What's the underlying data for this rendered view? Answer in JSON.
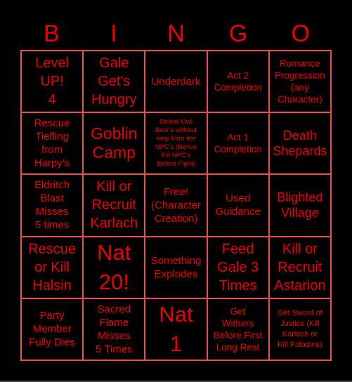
{
  "header": {
    "letters": [
      "B",
      "I",
      "N",
      "G",
      "O"
    ]
  },
  "colors": {
    "background": "#000000",
    "text": "#ee0000",
    "grid": "#f04a4a"
  },
  "board": {
    "rows": [
      [
        {
          "text": "Level\nUP!\n4",
          "size": "xl"
        },
        {
          "text": "Gale\nGet's\nHungry",
          "size": "xl"
        },
        {
          "text": "Underdark",
          "size": "md"
        },
        {
          "text": "Act 2\nCompletion",
          "size": "sm"
        },
        {
          "text": "Romance\nProgression\n(any\nCharacter)",
          "size": "sm"
        }
      ],
      [
        {
          "text": "Rescue\nTiefling\nfrom\nHarpy's",
          "size": "md"
        },
        {
          "text": "Goblin\nCamp",
          "size": "xxl"
        },
        {
          "text": "Defeat Owl\nBear's without\nhelp from the\nNPC's (Bonus\nKill NPC's\nBefore Fight)",
          "size": "xs"
        },
        {
          "text": "Act 1\nCompletion",
          "size": "sm"
        },
        {
          "text": "Death\nShepards",
          "size": "lg"
        }
      ],
      [
        {
          "text": "Eldritch\nBlast\nMisses\n5 times",
          "size": "md"
        },
        {
          "text": "Kill or\nRecruit\nKarlach",
          "size": "xl"
        },
        {
          "text": "Free!\n(Character\nCreation)",
          "size": "md"
        },
        {
          "text": "Used\nGuidance",
          "size": "md"
        },
        {
          "text": "Blighted\nVillage",
          "size": "lg"
        }
      ],
      [
        {
          "text": "Rescue\nor Kill\nHalsin",
          "size": "xl"
        },
        {
          "text": "Nat\n20!",
          "size": "huge"
        },
        {
          "text": "Something\nExplodes",
          "size": "md"
        },
        {
          "text": "Feed\nGale 3\nTimes",
          "size": "xl"
        },
        {
          "text": "Kill or\nRecruit\nAstarion",
          "size": "xl"
        }
      ],
      [
        {
          "text": "Party\nMember\nFully Dies",
          "size": "md"
        },
        {
          "text": "Sacred\nFlame\nMisses\n5 Times",
          "size": "md"
        },
        {
          "text": "Nat\n1",
          "size": "huge"
        },
        {
          "text": "Get\nWithers\nBefore First\nLong Rest",
          "size": "sm"
        },
        {
          "text": "Get Sword of\nJustice (Kill\nKarlach or\nKill Paladins)",
          "size": "xs2"
        }
      ]
    ]
  }
}
